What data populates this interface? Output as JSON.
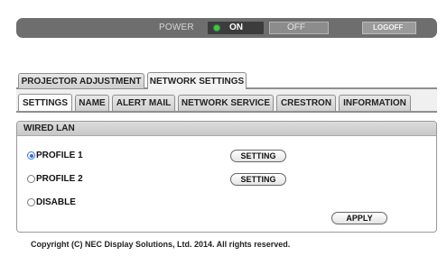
{
  "topbar": {
    "power_label": "POWER",
    "on_label": "ON",
    "off_label": "OFF",
    "logoff_label": "LOGOFF",
    "colors": {
      "bar": "#6e6e6e",
      "led": "#2fd13c"
    }
  },
  "main_tabs": [
    {
      "label": "PROJECTOR ADJUSTMENT",
      "active": false
    },
    {
      "label": "NETWORK SETTINGS",
      "active": true
    }
  ],
  "sub_tabs": [
    {
      "label": "SETTINGS",
      "active": true
    },
    {
      "label": "NAME",
      "active": false
    },
    {
      "label": "ALERT MAIL",
      "active": false
    },
    {
      "label": "NETWORK SERVICE",
      "active": false
    },
    {
      "label": "CRESTRON",
      "active": false
    },
    {
      "label": "INFORMATION",
      "active": false
    }
  ],
  "wired_lan": {
    "title": "WIRED LAN",
    "options": [
      {
        "label": "PROFILE 1",
        "selected": true,
        "button": "SETTING"
      },
      {
        "label": "PROFILE 2",
        "selected": false,
        "button": "SETTING"
      },
      {
        "label": "DISABLE",
        "selected": false
      }
    ],
    "apply_label": "APPLY"
  },
  "footer": {
    "copyright": "Copyright (C) NEC Display Solutions, Ltd. 2014. All rights reserved."
  }
}
